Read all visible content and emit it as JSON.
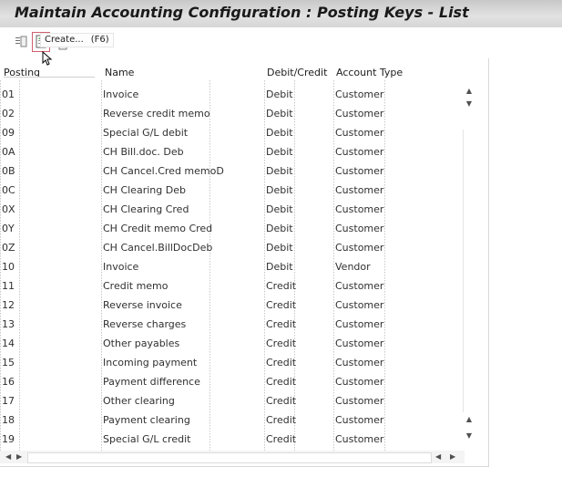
{
  "window": {
    "title": "Maintain Accounting Configuration : Posting Keys - List"
  },
  "toolbar": {
    "buttons": [
      {
        "name": "details-icon"
      },
      {
        "name": "create-icon"
      },
      {
        "name": "copy-icon"
      }
    ]
  },
  "tooltip": {
    "label": "Create...",
    "shortcut": "(F6)"
  },
  "table": {
    "columns": {
      "key": "Posting",
      "name": "Name",
      "debit_credit": "Debit/Credit",
      "account_type": "Account Type"
    },
    "rows": [
      {
        "key": "01",
        "name": "Invoice",
        "debit_credit": "Debit",
        "account_type": "Customer"
      },
      {
        "key": "02",
        "name": "Reverse credit memo",
        "debit_credit": "Debit",
        "account_type": "Customer"
      },
      {
        "key": "09",
        "name": "Special G/L debit",
        "debit_credit": "Debit",
        "account_type": "Customer"
      },
      {
        "key": "0A",
        "name": "CH Bill.doc. Deb",
        "debit_credit": "Debit",
        "account_type": "Customer"
      },
      {
        "key": "0B",
        "name": "CH Cancel.Cred memoD",
        "debit_credit": "Debit",
        "account_type": "Customer"
      },
      {
        "key": "0C",
        "name": "CH Clearing Deb",
        "debit_credit": "Debit",
        "account_type": "Customer"
      },
      {
        "key": "0X",
        "name": "CH Clearing Cred",
        "debit_credit": "Debit",
        "account_type": "Customer"
      },
      {
        "key": "0Y",
        "name": "CH Credit memo Cred",
        "debit_credit": "Debit",
        "account_type": "Customer"
      },
      {
        "key": "0Z",
        "name": "CH Cancel.BillDocDeb",
        "debit_credit": "Debit",
        "account_type": "Customer"
      },
      {
        "key": "10",
        "name": "Invoice",
        "debit_credit": "Debit",
        "account_type": "Vendor"
      },
      {
        "key": "11",
        "name": "Credit memo",
        "debit_credit": "Credit",
        "account_type": "Customer"
      },
      {
        "key": "12",
        "name": "Reverse invoice",
        "debit_credit": "Credit",
        "account_type": "Customer"
      },
      {
        "key": "13",
        "name": "Reverse charges",
        "debit_credit": "Credit",
        "account_type": "Customer"
      },
      {
        "key": "14",
        "name": "Other payables",
        "debit_credit": "Credit",
        "account_type": "Customer"
      },
      {
        "key": "15",
        "name": "Incoming payment",
        "debit_credit": "Credit",
        "account_type": "Customer"
      },
      {
        "key": "16",
        "name": "Payment difference",
        "debit_credit": "Credit",
        "account_type": "Customer"
      },
      {
        "key": "17",
        "name": "Other clearing",
        "debit_credit": "Credit",
        "account_type": "Customer"
      },
      {
        "key": "18",
        "name": "Payment clearing",
        "debit_credit": "Credit",
        "account_type": "Customer"
      },
      {
        "key": "19",
        "name": "Special G/L credit",
        "debit_credit": "Credit",
        "account_type": "Customer"
      }
    ]
  },
  "scroll_icons": {
    "up": "▲",
    "down": "▼",
    "left": "◀",
    "right": "▶"
  }
}
